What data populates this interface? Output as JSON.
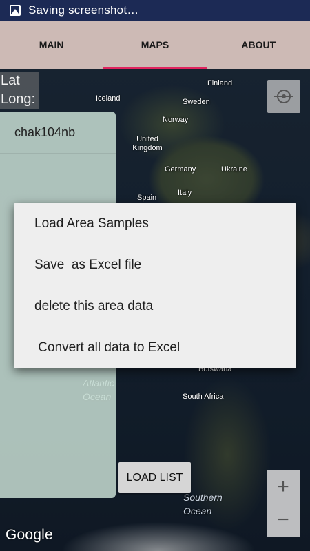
{
  "status_bar": {
    "notification_text": "Saving screenshot…",
    "icon": "image-icon"
  },
  "tabs": [
    {
      "label": "MAIN",
      "active": false
    },
    {
      "label": "MAPS",
      "active": true
    },
    {
      "label": "ABOUT",
      "active": false
    }
  ],
  "map": {
    "lat_label": "Lat",
    "long_label": "Long:",
    "labels": [
      "Iceland",
      "Finland",
      "Sweden",
      "Norway",
      "United Kingdom",
      "Germany",
      "Ukraine",
      "Italy",
      "Spain",
      "Botswana",
      "South Africa",
      "Atlantic Ocean"
    ],
    "ocean_labels": [
      "Southern Ocean"
    ],
    "attribution": "Google",
    "zoom_in": "+",
    "zoom_out": "−"
  },
  "area_list": {
    "items": [
      "chak104nb"
    ],
    "load_button": "LOAD LIST"
  },
  "context_menu": {
    "items": [
      "Load Area Samples",
      "Save  as Excel file",
      "delete this area data",
      " Convert all data to Excel"
    ]
  }
}
